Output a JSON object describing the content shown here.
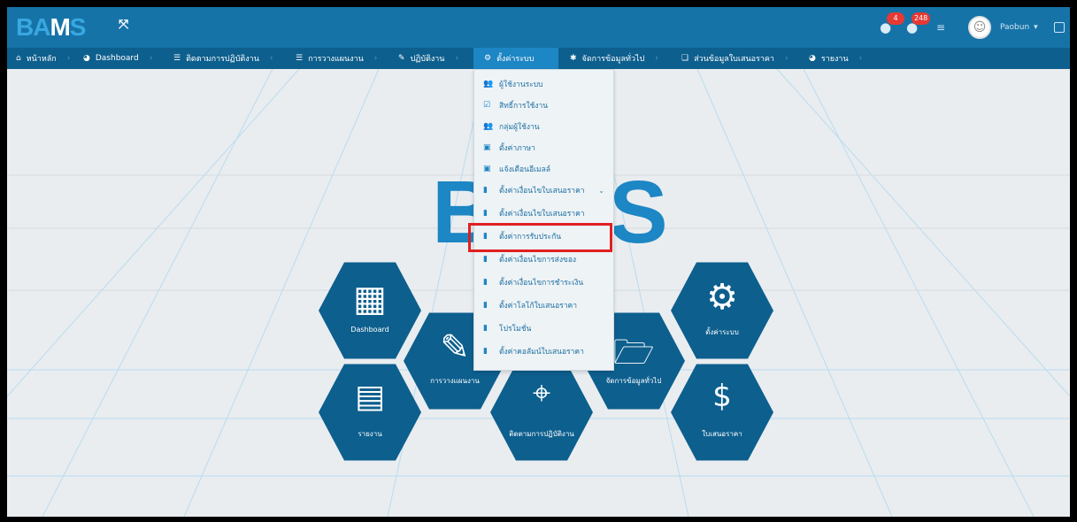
{
  "topbar": {
    "logo": {
      "part1": "BA",
      "part2": "M",
      "part3": "S"
    },
    "notifications_count": "4",
    "messages_count": "248",
    "username": "Paobun"
  },
  "nav": {
    "items": [
      {
        "label": "หน้าหลัก"
      },
      {
        "label": "Dashboard"
      },
      {
        "label": "ติดตามการปฏิบัติงาน"
      },
      {
        "label": "การวางแผนงาน"
      },
      {
        "label": "ปฏิบัติงาน"
      },
      {
        "label": "ตั้งค่าระบบ"
      },
      {
        "label": "จัดการข้อมูลทั่วไป"
      },
      {
        "label": "ส่วนข้อมูลใบเสนอราคา"
      },
      {
        "label": "รายงาน"
      }
    ]
  },
  "dropdown": {
    "items": [
      {
        "label": "ผู้ใช้งานระบบ",
        "icon": "users-icon"
      },
      {
        "label": "สิทธิ์การใช้งาน",
        "icon": "check-square-icon"
      },
      {
        "label": "กลุ่มผู้ใช้งาน",
        "icon": "users-icon"
      },
      {
        "label": "ตั้งค่าภาษา",
        "icon": "list-box-icon"
      },
      {
        "label": "แจ้งเตือนอีเมลล์",
        "icon": "list-box-icon"
      },
      {
        "label": "ตั้งค่าเงื่อนไขใบเสนอราคา",
        "icon": "clipboard-icon"
      },
      {
        "label": "ตั้งค่าเงื่อนไขใบเสนอราคา",
        "icon": "clipboard-icon"
      },
      {
        "label": "ตั้งค่าการรับประกัน",
        "icon": "clipboard-icon"
      },
      {
        "label": "ตั้งค่าเงื่อนไขการส่งของ",
        "icon": "clipboard-icon"
      },
      {
        "label": "ตั้งค่าเงื่อนไขการชำระเงิน",
        "icon": "clipboard-icon"
      },
      {
        "label": "ตั้งค่าโลโก้ใบเสนอราคา",
        "icon": "clipboard-icon"
      },
      {
        "label": "โปรโมชั่น",
        "icon": "clipboard-icon"
      },
      {
        "label": "ตั้งค่าคอลัมน์ใบเสนอราคา",
        "icon": "clipboard-icon"
      }
    ]
  },
  "background": {
    "logo_left": "B",
    "logo_right": "S",
    "tiles": [
      {
        "label": "Dashboard"
      },
      {
        "label": "การวางแผนงาน"
      },
      {
        "label": "รายงาน"
      },
      {
        "label": "ติดตามการปฏิบัติงาน"
      },
      {
        "label": "จัดการข้อมูลทั่วไป"
      },
      {
        "label": "ตั้งค่าระบบ"
      },
      {
        "label": "ใบเสนอราคา"
      }
    ]
  },
  "colors": {
    "primary": "#1673a8",
    "nav": "#0d5f8e",
    "highlight": "#e02020"
  }
}
